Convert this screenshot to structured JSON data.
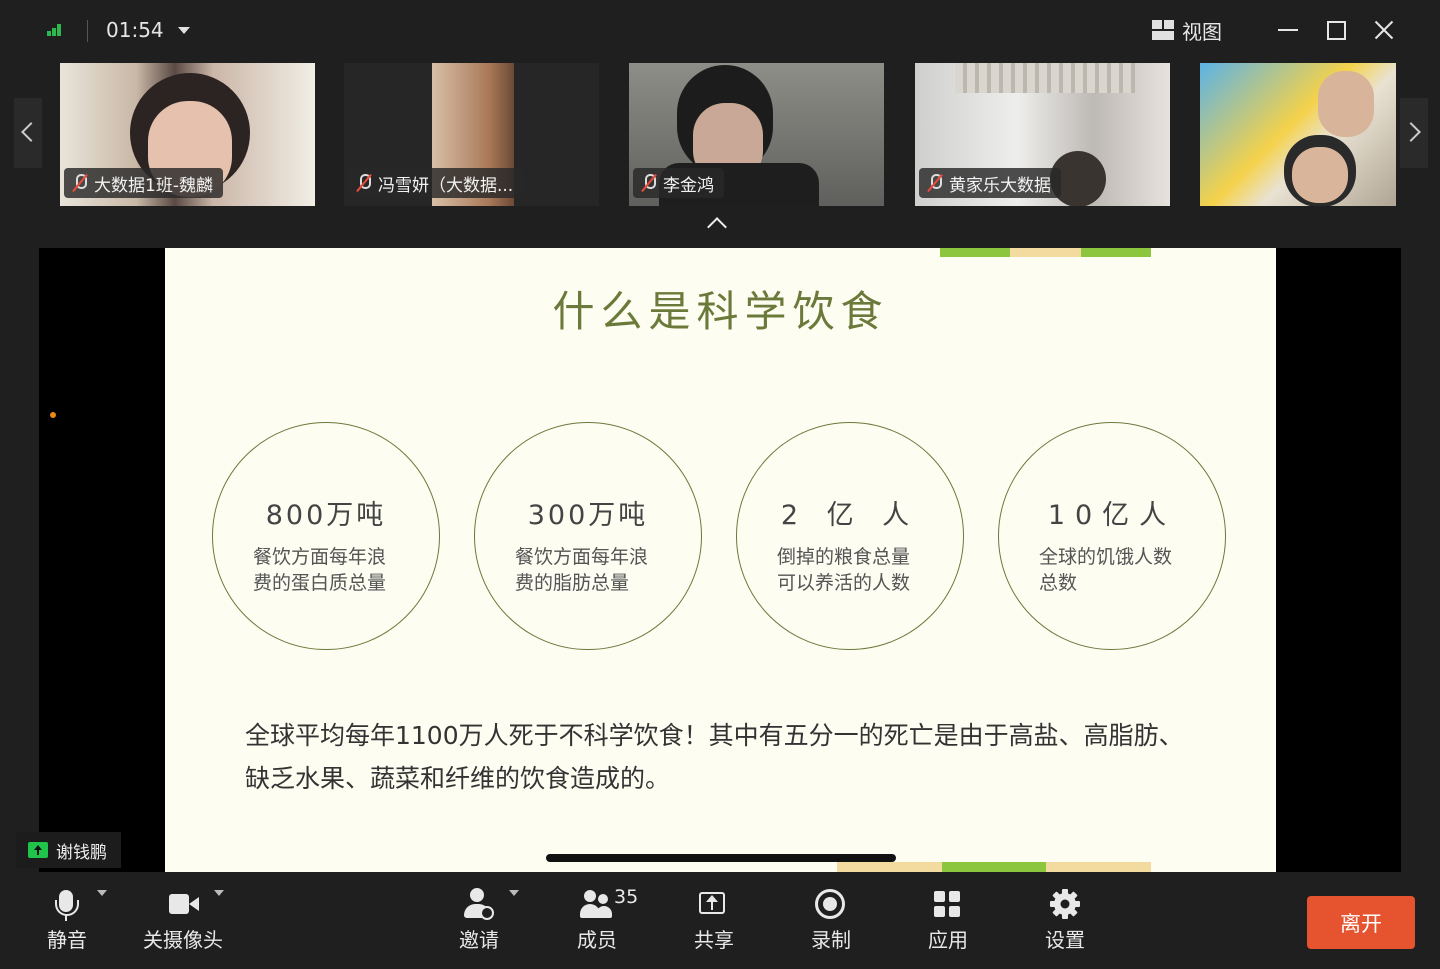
{
  "titlebar": {
    "timer": "01:54",
    "view_label": "视图"
  },
  "participants": [
    {
      "name": "大数据1班-魏麟",
      "muted": true
    },
    {
      "name": "冯雪妍（大数据...",
      "muted": true
    },
    {
      "name": "李金鸿",
      "muted": true
    },
    {
      "name": "黄家乐大数据",
      "muted": true
    },
    {
      "name": "",
      "muted": false
    }
  ],
  "slide": {
    "title": "什么是科学饮食",
    "stats": [
      {
        "value": "800万吨",
        "desc": "餐饮方面每年浪费的蛋白质总量"
      },
      {
        "value": "300万吨",
        "desc": "餐饮方面每年浪费的脂肪总量"
      },
      {
        "value": "2 亿 人",
        "desc": "倒掉的粮食总量可以养活的人数"
      },
      {
        "value": "10亿人",
        "desc": "全球的饥饿人数总数"
      }
    ],
    "summary": "全球平均每年1100万人死于不科学饮食！其中有五分一的死亡是由于高盐、高脂肪、缺乏水果、蔬菜和纤维的饮食造成的。",
    "colors": {
      "title": "#6b7a3a",
      "deco_green": "#8cc63f",
      "deco_tan": "#f3dba0"
    }
  },
  "presenter": {
    "name": "谢钱鹏"
  },
  "toolbar": {
    "mute": "静音",
    "camera": "关摄像头",
    "invite": "邀请",
    "members": "成员",
    "member_count": "35",
    "share": "共享",
    "record": "录制",
    "apps": "应用",
    "settings": "设置",
    "leave": "离开"
  }
}
